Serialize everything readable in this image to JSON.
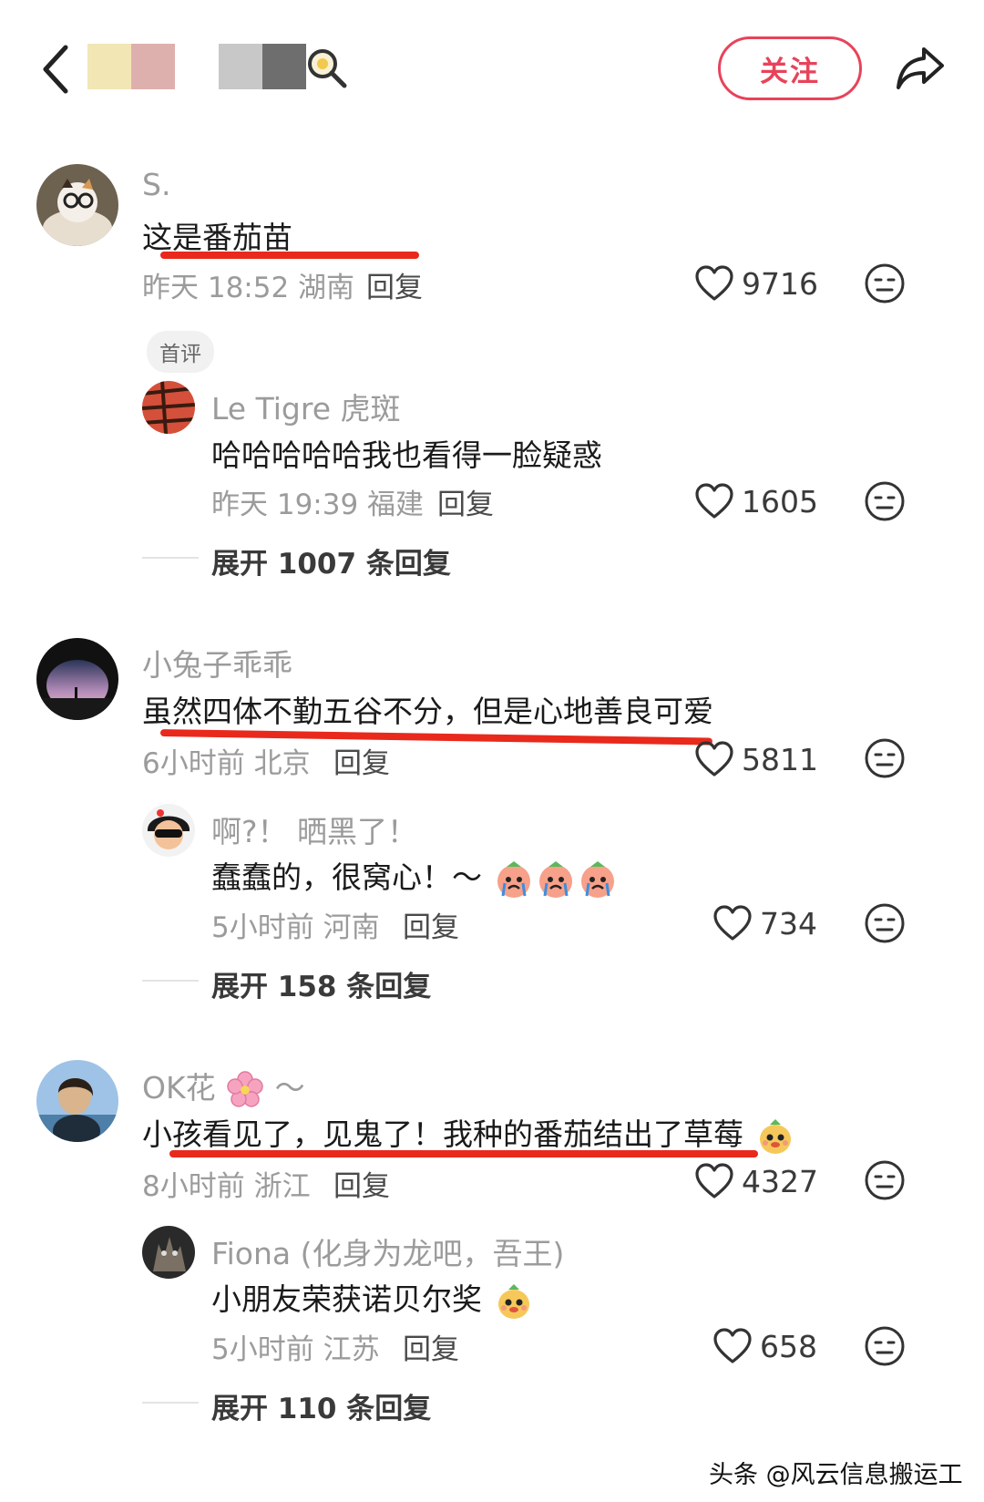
{
  "header": {
    "follow_label": "关注"
  },
  "comments": [
    {
      "user": "S.",
      "text": "这是番茄苗",
      "meta": "昨天 18:52 湖南",
      "reply_label": "回复",
      "likes": "9716",
      "badge": "首评",
      "replies": [
        {
          "user": "Le Tigre 虎斑",
          "text": "哈哈哈哈哈我也看得一脸疑惑",
          "meta": "昨天 19:39 福建",
          "reply_label": "回复",
          "likes": "1605"
        }
      ],
      "expand_label": "展开 1007 条回复"
    },
    {
      "user": "小兔子乖乖",
      "text": "虽然四体不勤五谷不分，但是心地善良可爱",
      "meta": "6小时前 北京",
      "reply_label": "回复",
      "likes": "5811",
      "replies": [
        {
          "user": "啊?！ 晒黑了！",
          "text": "蠢蠢的，很窝心！～",
          "meta": "5小时前 河南",
          "reply_label": "回复",
          "likes": "734"
        }
      ],
      "expand_label": "展开 158 条回复"
    },
    {
      "user": "OK花",
      "user_suffix": "～",
      "text": "小孩看见了，见鬼了！我种的番茄结出了草莓",
      "meta": "8小时前 浙江",
      "reply_label": "回复",
      "likes": "4327",
      "replies": [
        {
          "user": "Fiona (化身为龙吧，吾王)",
          "text": "小朋友荣获诺贝尔奖",
          "meta": "5小时前 江苏",
          "reply_label": "回复",
          "likes": "658"
        }
      ],
      "expand_label": "展开 110 条回复"
    }
  ],
  "watermark": "头条 @风云信息搬运工",
  "colors": {
    "accent": "#e8435a",
    "underline": "#e8291c",
    "meta_gray": "#9b9b9b"
  },
  "icons": [
    "back-icon",
    "search-icon",
    "share-icon",
    "heart-icon",
    "face-icon",
    "cherry-blossom-icon",
    "crying-emoji",
    "mango-emoji"
  ]
}
